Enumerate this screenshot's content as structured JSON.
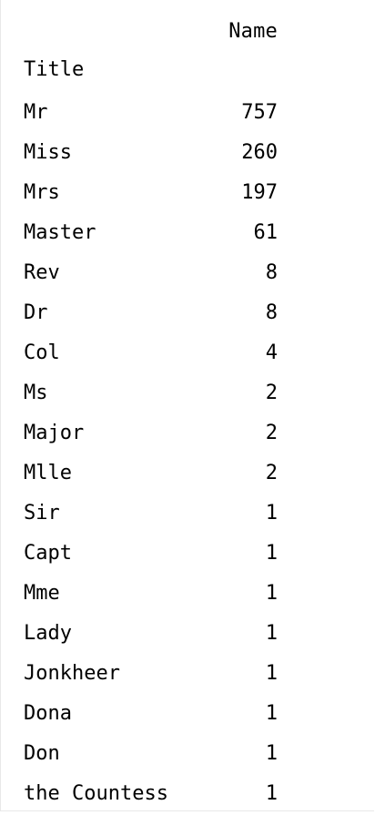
{
  "table": {
    "column_header": "Name",
    "index_name": "Title",
    "rows": [
      {
        "title": "Mr",
        "count": "757"
      },
      {
        "title": "Miss",
        "count": "260"
      },
      {
        "title": "Mrs",
        "count": "197"
      },
      {
        "title": "Master",
        "count": "61"
      },
      {
        "title": "Rev",
        "count": "8"
      },
      {
        "title": "Dr",
        "count": "8"
      },
      {
        "title": "Col",
        "count": "4"
      },
      {
        "title": "Ms",
        "count": "2"
      },
      {
        "title": "Major",
        "count": "2"
      },
      {
        "title": "Mlle",
        "count": "2"
      },
      {
        "title": "Sir",
        "count": "1"
      },
      {
        "title": "Capt",
        "count": "1"
      },
      {
        "title": "Mme",
        "count": "1"
      },
      {
        "title": "Lady",
        "count": "1"
      },
      {
        "title": "Jonkheer",
        "count": "1"
      },
      {
        "title": "Dona",
        "count": "1"
      },
      {
        "title": "Don",
        "count": "1"
      },
      {
        "title": "the Countess",
        "count": "1"
      }
    ]
  }
}
